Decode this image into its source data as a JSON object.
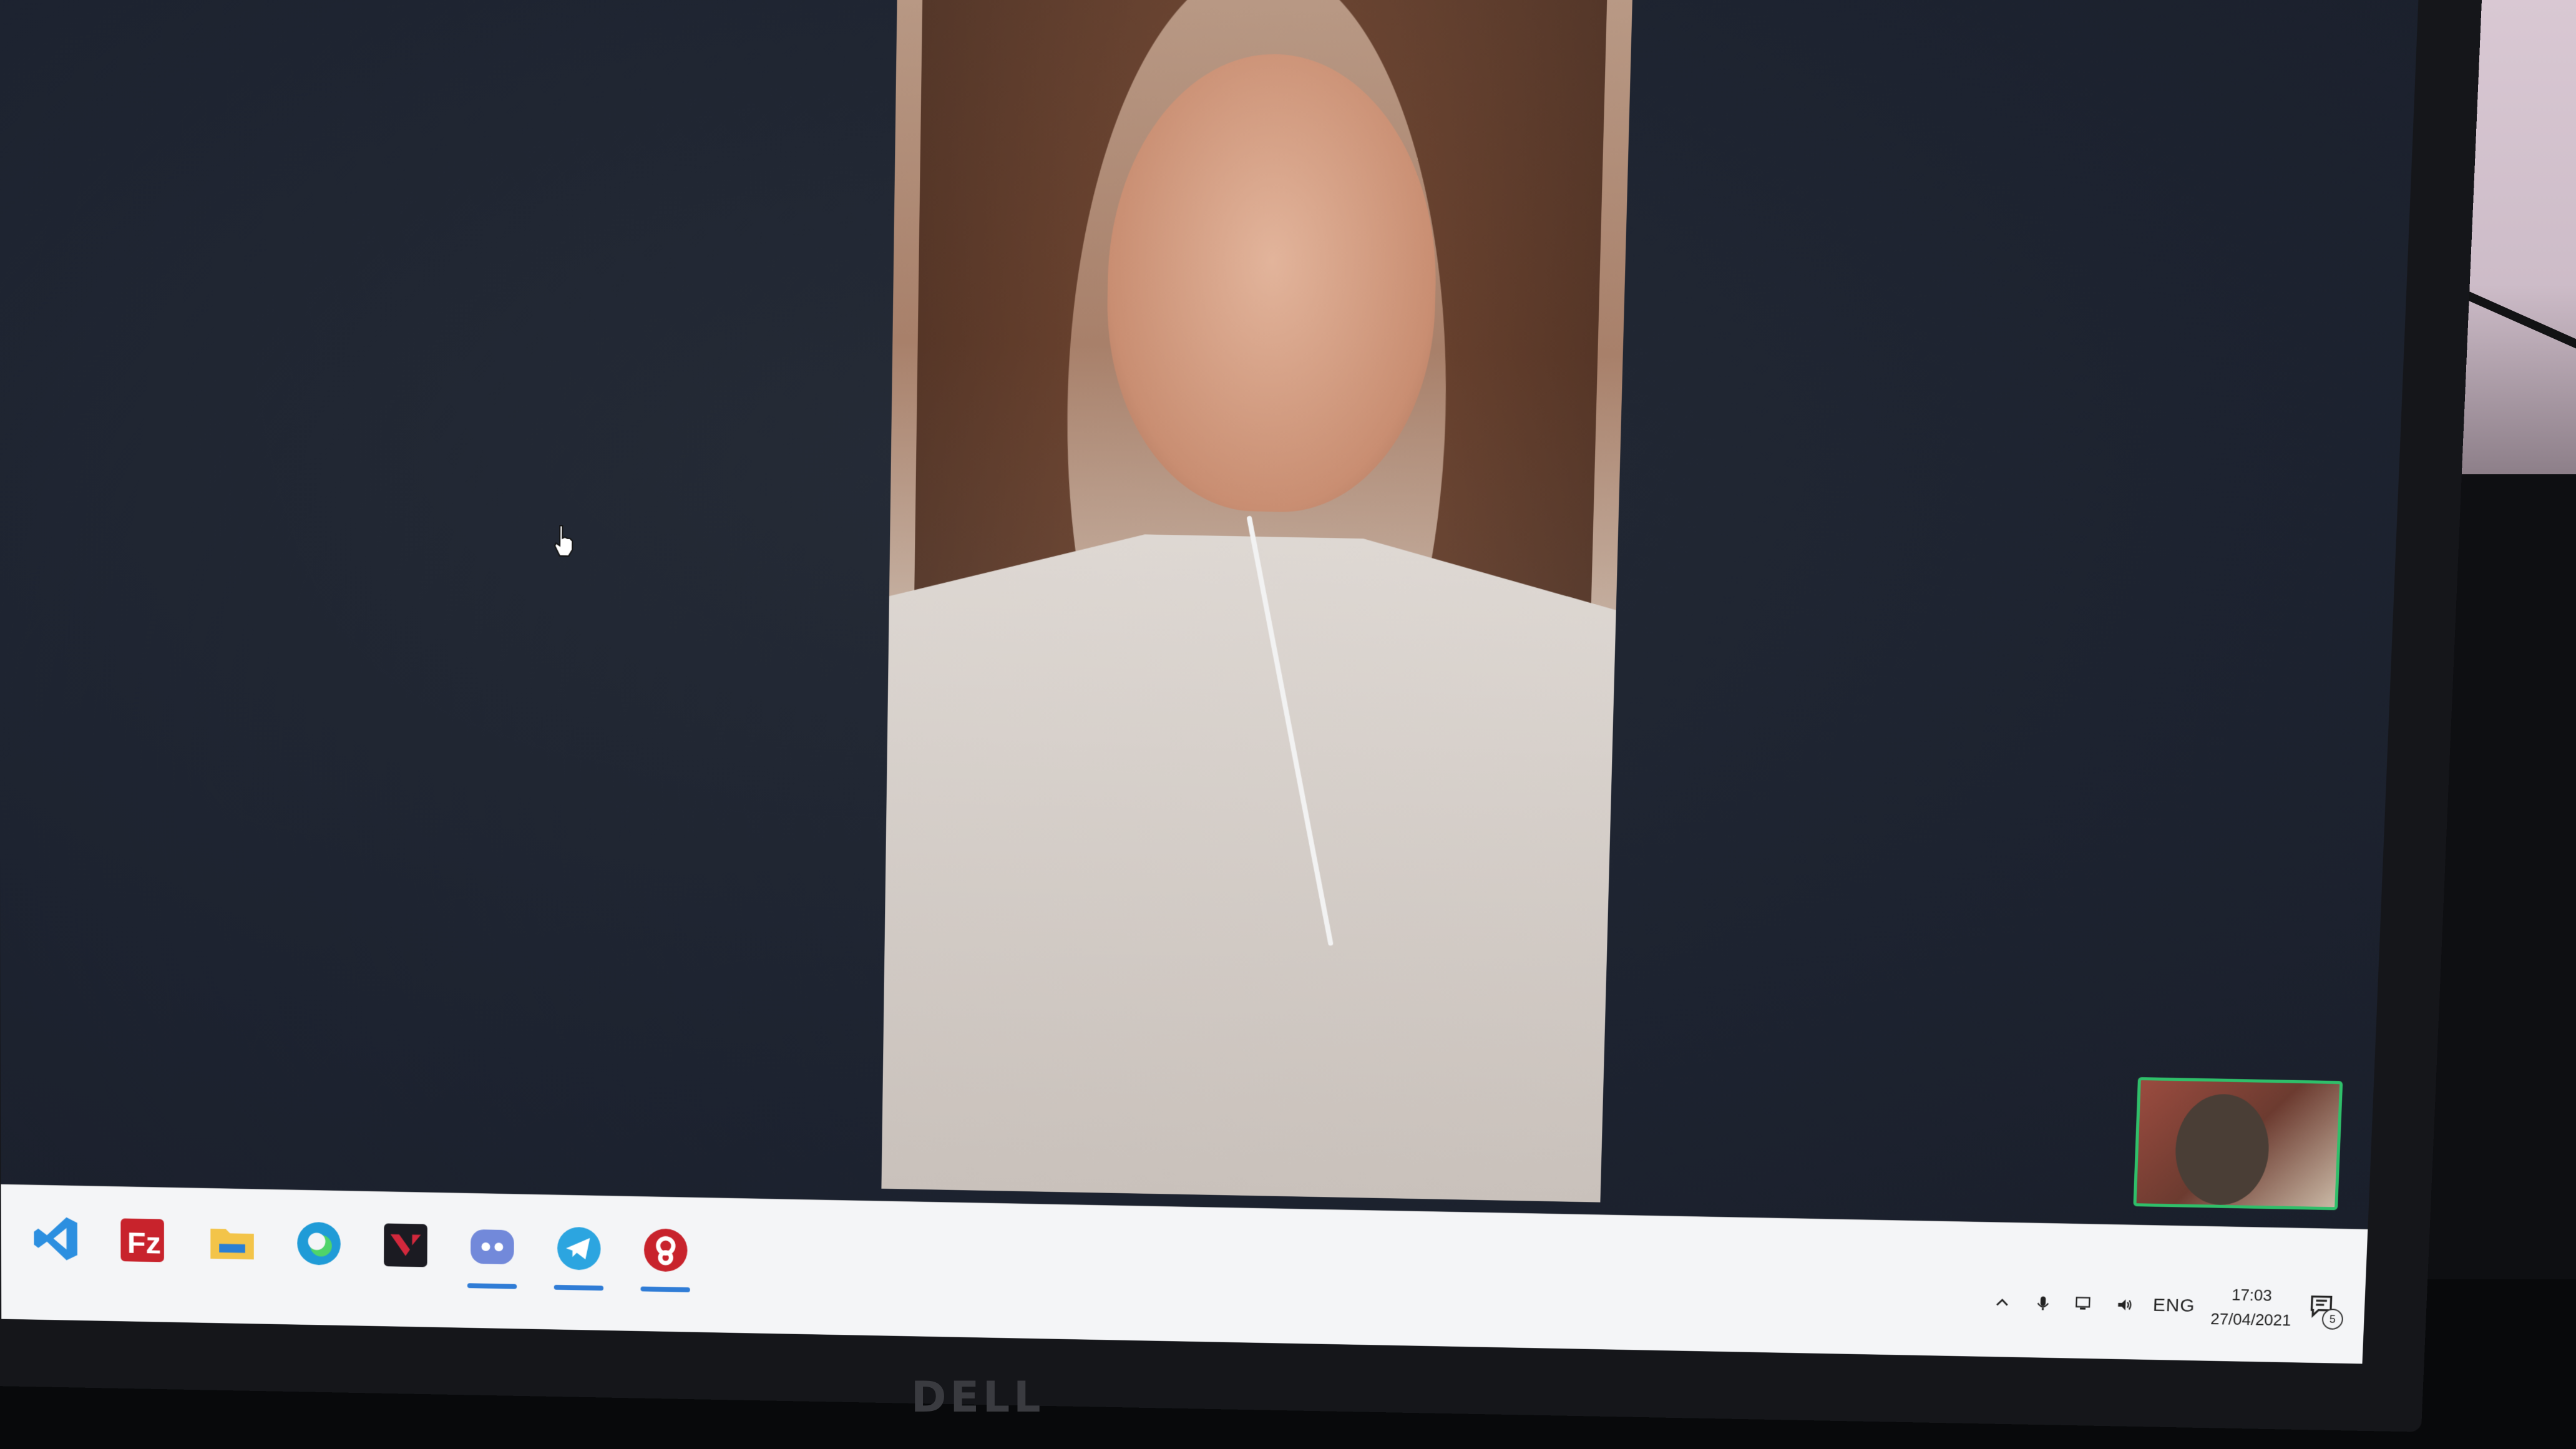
{
  "taskbar": {
    "apps": [
      {
        "name": "Visual Studio Code",
        "icon": "vscode-icon",
        "color": "#2c8fe0",
        "active": false
      },
      {
        "name": "FileZilla",
        "icon": "filezilla-icon",
        "color": "#c8232c",
        "active": false
      },
      {
        "name": "File Explorer",
        "icon": "folder-icon",
        "color": "#f3c449",
        "active": false
      },
      {
        "name": "Microsoft Edge",
        "icon": "edge-icon",
        "color": "#1f9bd7",
        "active": false
      },
      {
        "name": "Valorant",
        "icon": "valorant-icon",
        "color": "#d2283c",
        "active": false
      },
      {
        "name": "Discord",
        "icon": "discord-icon",
        "color": "#7289da",
        "active": true
      },
      {
        "name": "Telegram",
        "icon": "telegram-icon",
        "color": "#2ca5e0",
        "active": true
      },
      {
        "name": "Unknown app",
        "icon": "app-icon",
        "color": "#c8232c",
        "active": true
      }
    ]
  },
  "tray": {
    "lang": "ENG",
    "time": "17:03",
    "date": "27/04/2021",
    "notifications": "5"
  },
  "monitor": {
    "brand": "DELL"
  },
  "accent": "#2fbf6a"
}
